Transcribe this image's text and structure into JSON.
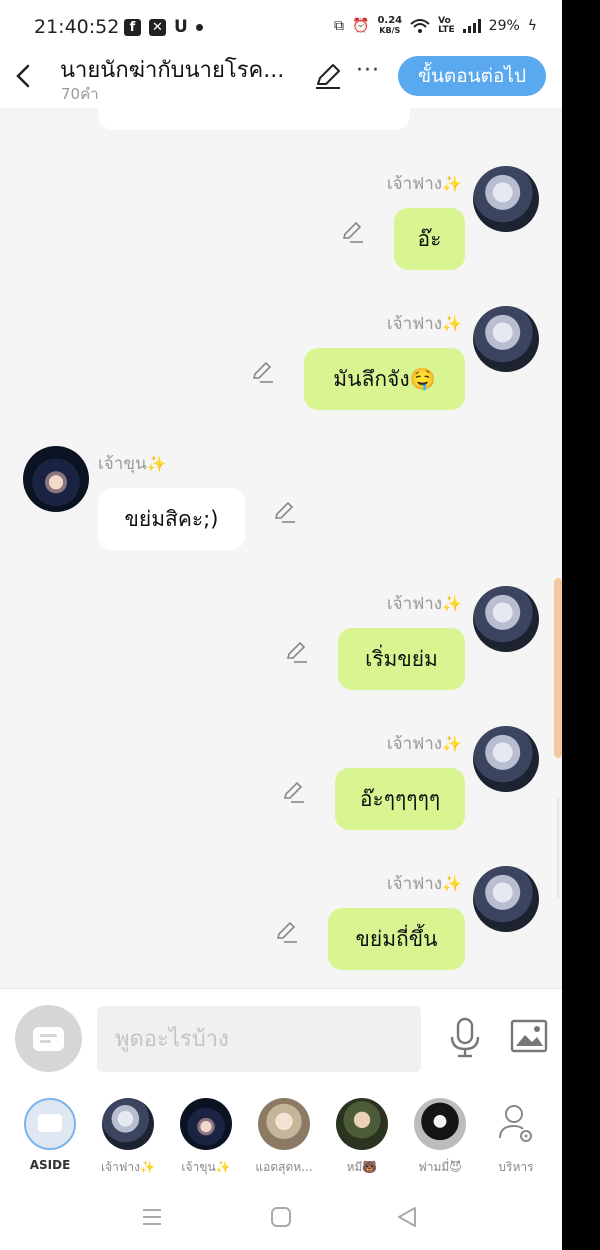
{
  "status_bar": {
    "time": "21:40:52",
    "net_speed_value": "0.24",
    "net_speed_unit": "KB/S",
    "battery": "29%"
  },
  "header": {
    "title": "นายนักฆ่ากับนายโรค...",
    "word_count": "70คำ",
    "next_button": "ขั้นตอนต่อไป"
  },
  "messages": [
    {
      "sender": "เจ้าฟาง",
      "text": "อ๊ะ",
      "side": "right"
    },
    {
      "sender": "เจ้าฟาง",
      "text": "มันลึกจัง🤤",
      "side": "right"
    },
    {
      "sender": "เจ้าขุน",
      "text": "ขย่มสิคะ;)",
      "side": "left"
    },
    {
      "sender": "เจ้าฟาง",
      "text": "เริ่มขย่ม",
      "side": "right"
    },
    {
      "sender": "เจ้าฟาง",
      "text": "อ๊ะๆๆๆๆๆ",
      "side": "right"
    },
    {
      "sender": "เจ้าฟาง",
      "text": "ขย่มถี่ขึ้น",
      "side": "right"
    }
  ],
  "input": {
    "placeholder": "พูดอะไรบ้าง"
  },
  "participants": [
    {
      "label": "ASIDE"
    },
    {
      "label": "เจ้าฟาง✨"
    },
    {
      "label": "เจ้าขุน✨"
    },
    {
      "label": "แอดสุดห..."
    },
    {
      "label": "หมี🐻"
    },
    {
      "label": "ฟามมี่😈"
    },
    {
      "label": "บริหาร"
    }
  ],
  "colors": {
    "my_bubble": "#d9f592",
    "their_bubble": "#ffffff",
    "accent_button": "#5aa9ee",
    "sparkle": "#f2c21c"
  }
}
